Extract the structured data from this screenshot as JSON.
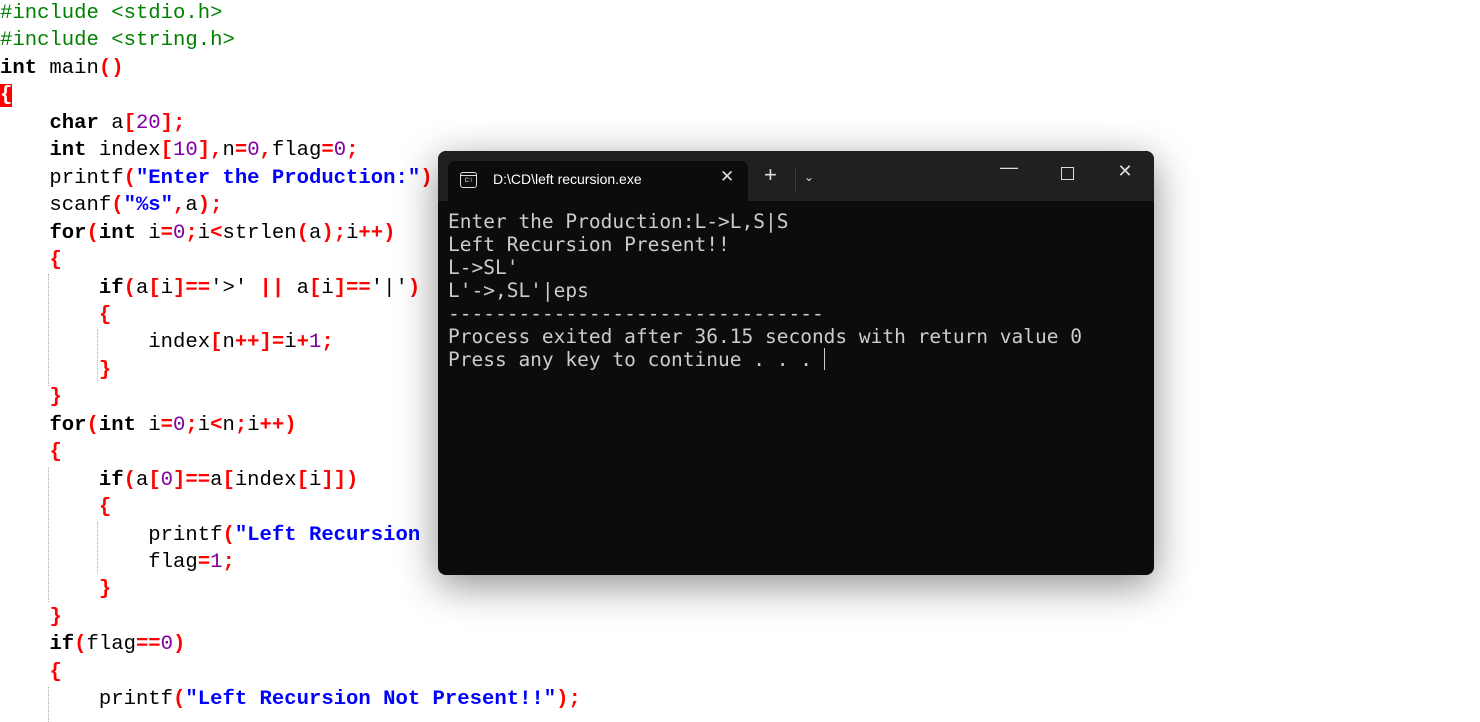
{
  "editor": {
    "lines": [
      [
        {
          "t": "#include <stdio.h>",
          "c": "pp"
        }
      ],
      [
        {
          "t": "#include <string.h>",
          "c": "pp"
        }
      ],
      [
        {
          "t": "int",
          "c": "kw"
        },
        {
          "t": " main",
          "c": "id"
        },
        {
          "t": "()",
          "c": "sym"
        }
      ],
      [
        {
          "t": "{",
          "c": "hl"
        }
      ],
      [
        {
          "t": "    ",
          "c": "id"
        },
        {
          "t": "char",
          "c": "kw"
        },
        {
          "t": " a",
          "c": "id"
        },
        {
          "t": "[",
          "c": "sym"
        },
        {
          "t": "20",
          "c": "num"
        },
        {
          "t": "];",
          "c": "sym"
        }
      ],
      [
        {
          "t": "    ",
          "c": "id"
        },
        {
          "t": "int",
          "c": "kw"
        },
        {
          "t": " index",
          "c": "id"
        },
        {
          "t": "[",
          "c": "sym"
        },
        {
          "t": "10",
          "c": "num"
        },
        {
          "t": "],",
          "c": "sym"
        },
        {
          "t": "n",
          "c": "id"
        },
        {
          "t": "=",
          "c": "sym"
        },
        {
          "t": "0",
          "c": "num"
        },
        {
          "t": ",",
          "c": "sym"
        },
        {
          "t": "flag",
          "c": "id"
        },
        {
          "t": "=",
          "c": "sym"
        },
        {
          "t": "0",
          "c": "num"
        },
        {
          "t": ";",
          "c": "sym"
        }
      ],
      [
        {
          "t": "    printf",
          "c": "id"
        },
        {
          "t": "(",
          "c": "sym"
        },
        {
          "t": "\"Enter the Production:\"",
          "c": "str"
        },
        {
          "t": ")",
          "c": "sym"
        }
      ],
      [
        {
          "t": "    scanf",
          "c": "id"
        },
        {
          "t": "(",
          "c": "sym"
        },
        {
          "t": "\"%s\"",
          "c": "str"
        },
        {
          "t": ",",
          "c": "sym"
        },
        {
          "t": "a",
          "c": "id"
        },
        {
          "t": ");",
          "c": "sym"
        }
      ],
      [
        {
          "t": "    ",
          "c": "id"
        },
        {
          "t": "for",
          "c": "kw"
        },
        {
          "t": "(",
          "c": "sym"
        },
        {
          "t": "int",
          "c": "kw"
        },
        {
          "t": " i",
          "c": "id"
        },
        {
          "t": "=",
          "c": "sym"
        },
        {
          "t": "0",
          "c": "num"
        },
        {
          "t": ";",
          "c": "sym"
        },
        {
          "t": "i",
          "c": "id"
        },
        {
          "t": "<",
          "c": "sym"
        },
        {
          "t": "strlen",
          "c": "id"
        },
        {
          "t": "(",
          "c": "sym"
        },
        {
          "t": "a",
          "c": "id"
        },
        {
          "t": ");",
          "c": "sym"
        },
        {
          "t": "i",
          "c": "id"
        },
        {
          "t": "++)",
          "c": "sym"
        }
      ],
      [
        {
          "t": "    ",
          "c": "id"
        },
        {
          "t": "{",
          "c": "sym"
        }
      ],
      [
        {
          "t": "        ",
          "c": "id"
        },
        {
          "t": "if",
          "c": "kw"
        },
        {
          "t": "(",
          "c": "sym"
        },
        {
          "t": "a",
          "c": "id"
        },
        {
          "t": "[",
          "c": "sym"
        },
        {
          "t": "i",
          "c": "id"
        },
        {
          "t": "]==",
          "c": "sym"
        },
        {
          "t": "'>'",
          "c": "id"
        },
        {
          "t": " || ",
          "c": "sym"
        },
        {
          "t": "a",
          "c": "id"
        },
        {
          "t": "[",
          "c": "sym"
        },
        {
          "t": "i",
          "c": "id"
        },
        {
          "t": "]==",
          "c": "sym"
        },
        {
          "t": "'|'",
          "c": "id"
        },
        {
          "t": ")",
          "c": "sym"
        }
      ],
      [
        {
          "t": "        ",
          "c": "id"
        },
        {
          "t": "{",
          "c": "sym"
        }
      ],
      [
        {
          "t": "            index",
          "c": "id"
        },
        {
          "t": "[",
          "c": "sym"
        },
        {
          "t": "n",
          "c": "id"
        },
        {
          "t": "++]=",
          "c": "sym"
        },
        {
          "t": "i",
          "c": "id"
        },
        {
          "t": "+",
          "c": "sym"
        },
        {
          "t": "1",
          "c": "num"
        },
        {
          "t": ";",
          "c": "sym"
        }
      ],
      [
        {
          "t": "        ",
          "c": "id"
        },
        {
          "t": "}",
          "c": "sym"
        }
      ],
      [
        {
          "t": "    ",
          "c": "id"
        },
        {
          "t": "}",
          "c": "sym"
        }
      ],
      [
        {
          "t": "    ",
          "c": "id"
        },
        {
          "t": "for",
          "c": "kw"
        },
        {
          "t": "(",
          "c": "sym"
        },
        {
          "t": "int",
          "c": "kw"
        },
        {
          "t": " i",
          "c": "id"
        },
        {
          "t": "=",
          "c": "sym"
        },
        {
          "t": "0",
          "c": "num"
        },
        {
          "t": ";",
          "c": "sym"
        },
        {
          "t": "i",
          "c": "id"
        },
        {
          "t": "<",
          "c": "sym"
        },
        {
          "t": "n",
          "c": "id"
        },
        {
          "t": ";",
          "c": "sym"
        },
        {
          "t": "i",
          "c": "id"
        },
        {
          "t": "++)",
          "c": "sym"
        }
      ],
      [
        {
          "t": "    ",
          "c": "id"
        },
        {
          "t": "{",
          "c": "sym"
        }
      ],
      [
        {
          "t": "        ",
          "c": "id"
        },
        {
          "t": "if",
          "c": "kw"
        },
        {
          "t": "(",
          "c": "sym"
        },
        {
          "t": "a",
          "c": "id"
        },
        {
          "t": "[",
          "c": "sym"
        },
        {
          "t": "0",
          "c": "num"
        },
        {
          "t": "]==",
          "c": "sym"
        },
        {
          "t": "a",
          "c": "id"
        },
        {
          "t": "[",
          "c": "sym"
        },
        {
          "t": "index",
          "c": "id"
        },
        {
          "t": "[",
          "c": "sym"
        },
        {
          "t": "i",
          "c": "id"
        },
        {
          "t": "]])",
          "c": "sym"
        }
      ],
      [
        {
          "t": "        ",
          "c": "id"
        },
        {
          "t": "{",
          "c": "sym"
        }
      ],
      [
        {
          "t": "            printf",
          "c": "id"
        },
        {
          "t": "(",
          "c": "sym"
        },
        {
          "t": "\"Left Recursion",
          "c": "str"
        }
      ],
      [
        {
          "t": "            flag",
          "c": "id"
        },
        {
          "t": "=",
          "c": "sym"
        },
        {
          "t": "1",
          "c": "num"
        },
        {
          "t": ";",
          "c": "sym"
        }
      ],
      [
        {
          "t": "        ",
          "c": "id"
        },
        {
          "t": "}",
          "c": "sym"
        }
      ],
      [
        {
          "t": "    ",
          "c": "id"
        },
        {
          "t": "}",
          "c": "sym"
        }
      ],
      [
        {
          "t": "    ",
          "c": "id"
        },
        {
          "t": "if",
          "c": "kw"
        },
        {
          "t": "(",
          "c": "sym"
        },
        {
          "t": "flag",
          "c": "id"
        },
        {
          "t": "==",
          "c": "sym"
        },
        {
          "t": "0",
          "c": "num"
        },
        {
          "t": ")",
          "c": "sym"
        }
      ],
      [
        {
          "t": "    ",
          "c": "id"
        },
        {
          "t": "{",
          "c": "sym"
        }
      ],
      [
        {
          "t": "        printf",
          "c": "id"
        },
        {
          "t": "(",
          "c": "sym"
        },
        {
          "t": "\"Left Recursion Not Present!!\"",
          "c": "str"
        },
        {
          "t": ");",
          "c": "sym"
        }
      ]
    ]
  },
  "terminal": {
    "tab_title": "D:\\CD\\left recursion.exe",
    "tab_icon": "terminal-icon",
    "tab_icon_text": "C:\\",
    "close_tab": "✕",
    "new_tab": "+",
    "dropdown": "⌄",
    "minimize": "—",
    "close": "✕",
    "output": [
      "Enter the Production:L->L,S|S",
      "Left Recursion Present!!",
      "L->SL'",
      "L'->,SL'|eps",
      "--------------------------------",
      "Process exited after 36.15 seconds with return value 0",
      "Press any key to continue . . . "
    ]
  }
}
